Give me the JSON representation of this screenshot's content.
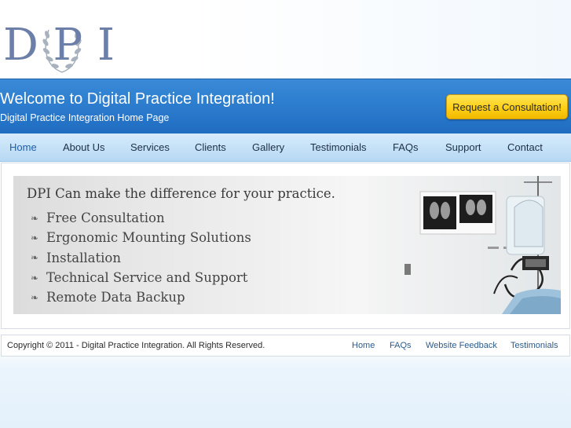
{
  "logo": {
    "letters": [
      "D",
      "P",
      "I"
    ]
  },
  "header": {
    "title": "Welcome to Digital Practice Integration!",
    "subtitle": "Digital Practice Integration Home Page",
    "cta_label": "Request a Consultation!"
  },
  "nav": {
    "items": [
      {
        "label": "Home",
        "active": true
      },
      {
        "label": "About Us"
      },
      {
        "label": "Services"
      },
      {
        "label": "Clients"
      },
      {
        "label": "Gallery"
      },
      {
        "label": "Testimonials"
      },
      {
        "label": "FAQs"
      },
      {
        "label": "Support"
      },
      {
        "label": "Contact"
      }
    ]
  },
  "banner": {
    "headline": "DPI Can make the difference for your practice.",
    "bullet_icon": "fleuron-bullet-icon",
    "items": [
      "Free Consultation",
      "Ergonomic Mounting Solutions",
      "Installation",
      "Technical Service and Support",
      "Remote Data Backup"
    ]
  },
  "footer": {
    "copyright": "Copyright © 2011 - Digital Practice Integration. All Rights Reserved.",
    "links": [
      "Home",
      "FAQs",
      "Website Feedback",
      "Testimonials"
    ]
  },
  "colors": {
    "header_blue": "#2f7fd0",
    "nav_blue": "#c3e0f7",
    "cta_yellow": "#ffd21a",
    "logo_slate": "#6b7fa8"
  }
}
